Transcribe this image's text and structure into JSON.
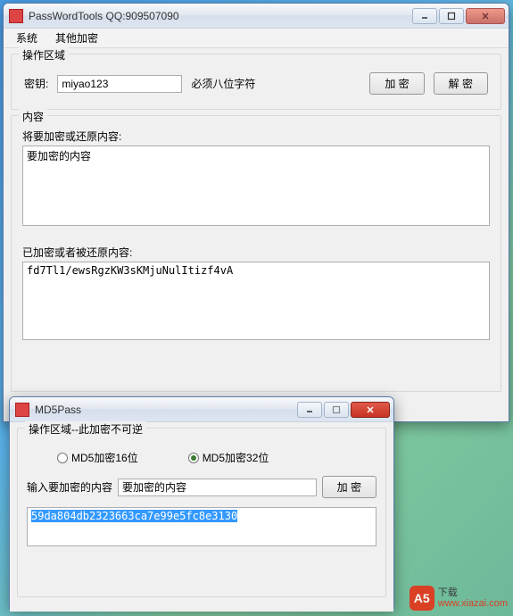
{
  "mainWindow": {
    "title": "PassWordTools  QQ:909507090",
    "menu": {
      "system": "系统",
      "otherEncrypt": "其他加密"
    },
    "opGroup": {
      "legend": "操作区域",
      "keyLabel": "密钥:",
      "keyValue": "miyao123",
      "keyHint": "必须八位字符",
      "encryptBtn": "加 密",
      "decryptBtn": "解 密"
    },
    "contentGroup": {
      "legend": "内容",
      "srcLabel": "将要加密或还原内容:",
      "srcValue": "要加密的内容",
      "dstLabel": "已加密或者被还原内容:",
      "dstValue": "fd7Tl1/ewsRgzKW3sKMjuNulItizf4vA"
    }
  },
  "md5Window": {
    "title": "MD5Pass",
    "opGroup": {
      "legend": "操作区域--此加密不可逆",
      "radio16": "MD5加密16位",
      "radio32": "MD5加密32位",
      "selected": "32",
      "inputLabel": "输入要加密的内容",
      "inputValue": "要加密的内容",
      "encryptBtn": "加 密",
      "resultValue": "59da804db2323663ca7e99e5fc8e3130"
    }
  },
  "watermark": {
    "badge": "A5",
    "line1": "下载",
    "line2": "www.xiazai.com"
  }
}
